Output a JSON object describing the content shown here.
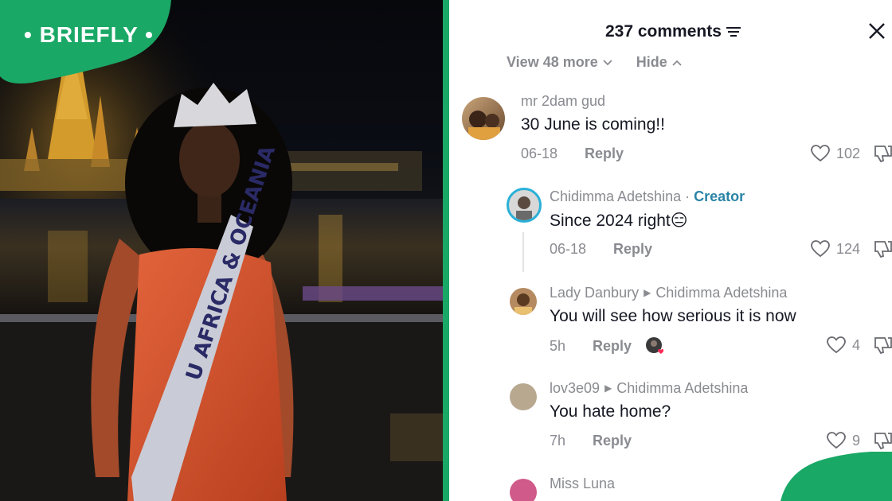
{
  "brand": {
    "name": "BRIEFLY",
    "color": "#1aa866"
  },
  "photo": {
    "sash_text": "U AFRICA & OCEANIA"
  },
  "comments_header": {
    "title": "237 comments",
    "filter_icon": "filter-icon",
    "close_icon": "close-icon"
  },
  "thread_controls": {
    "view_more": "View 48 more",
    "hide": "Hide"
  },
  "comments": [
    {
      "username": "mr 2dam gud",
      "text": "30 June is coming!!",
      "time": "06-18",
      "reply": "Reply",
      "likes": "102"
    },
    {
      "username": "Chidimma Adetshina",
      "badge": "Creator",
      "separator": "·",
      "text": "Since 2024 right😑",
      "time": "06-18",
      "reply": "Reply",
      "likes": "124"
    },
    {
      "username": "Lady Danbury",
      "reply_to": "Chidimma Adetshina",
      "text": "You will see how serious it is now",
      "time": "5h",
      "reply": "Reply",
      "likes": "4"
    },
    {
      "username": "lov3e09",
      "reply_to": "Chidimma Adetshina",
      "text": "You hate home?",
      "time": "7h",
      "reply": "Reply",
      "likes": "9"
    },
    {
      "username": "Miss Luna"
    }
  ],
  "colors": {
    "accent_creator": "#2b84a6",
    "muted": "#8a8b91",
    "text": "#161823",
    "brand_green": "#1aa866"
  }
}
